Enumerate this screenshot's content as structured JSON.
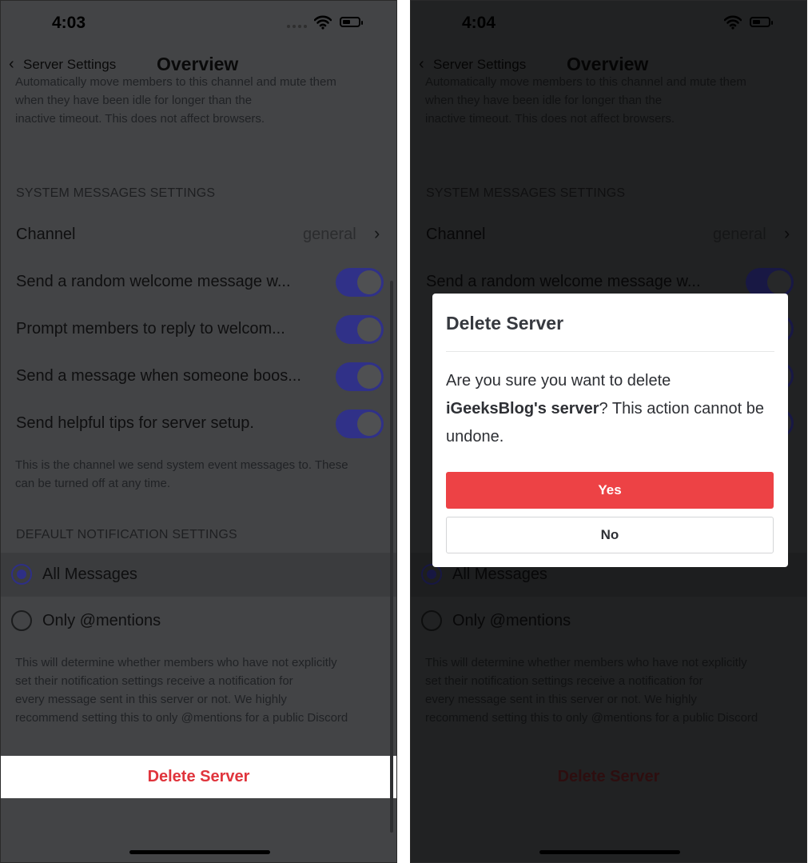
{
  "left": {
    "status": {
      "time": "4:03"
    },
    "nav": {
      "back_label": "Server Settings",
      "title": "Overview"
    },
    "inactive_desc": [
      "Automatically move members to this channel and mute them",
      "when they have been idle for longer than the",
      "inactive timeout. This does not affect browsers."
    ],
    "system_messages": {
      "header": "SYSTEM MESSAGES SETTINGS",
      "channel_label": "Channel",
      "channel_value": "general",
      "toggles": [
        {
          "label": "Send a random welcome message w...",
          "on": true
        },
        {
          "label": "Prompt members to reply to welcom...",
          "on": true
        },
        {
          "label": "Send a message when someone boos...",
          "on": true
        },
        {
          "label": "Send helpful tips for server setup.",
          "on": true
        }
      ],
      "desc": [
        "This is the channel we send system event messages to. These",
        "can be turned off at any time."
      ]
    },
    "notifications": {
      "header": "DEFAULT NOTIFICATION SETTINGS",
      "options": [
        {
          "label": "All Messages",
          "selected": true
        },
        {
          "label": "Only @mentions",
          "selected": false
        }
      ],
      "desc": [
        "This will determine whether members who have not explicitly",
        "set their notification settings receive a notification for",
        "every message sent in this server or not. We highly",
        "recommend setting this to only @mentions for a public Discord"
      ]
    },
    "delete_label": "Delete Server"
  },
  "right": {
    "status": {
      "time": "4:04"
    },
    "nav": {
      "back_label": "Server Settings",
      "title": "Overview"
    },
    "inactive_desc": [
      "Automatically move members to this channel and mute them",
      "when they have been idle for longer than the",
      "inactive timeout. This does not affect browsers."
    ],
    "system_messages": {
      "header": "SYSTEM MESSAGES SETTINGS",
      "channel_label": "Channel",
      "channel_value": "general",
      "toggles": [
        {
          "label": "Send a random welcome message w...",
          "on": true
        }
      ]
    },
    "notifications": {
      "options": [
        {
          "label": "All Messages",
          "selected": true
        },
        {
          "label": "Only @mentions",
          "selected": false
        }
      ],
      "desc": [
        "This will determine whether members who have not explicitly",
        "set their notification settings receive a notification for",
        "every message sent in this server or not. We highly",
        "recommend setting this to only @mentions for a public Discord"
      ]
    },
    "delete_label": "Delete Server",
    "dialog": {
      "title": "Delete Server",
      "body_prefix": "Are you sure you want to delete",
      "server_name": "iGeeksBlog's server",
      "body_suffix": "? This action cannot be undone.",
      "yes_label": "Yes",
      "no_label": "No"
    }
  },
  "colors": {
    "toggle_on": "#303188",
    "danger": "#e0343c",
    "dialog_yes": "#ed4245",
    "phone_dim_bg": "#434446"
  },
  "icons": [
    "back-chevron-icon",
    "chevron-right-icon",
    "wifi-icon",
    "battery-icon",
    "signal-dots-icon"
  ]
}
